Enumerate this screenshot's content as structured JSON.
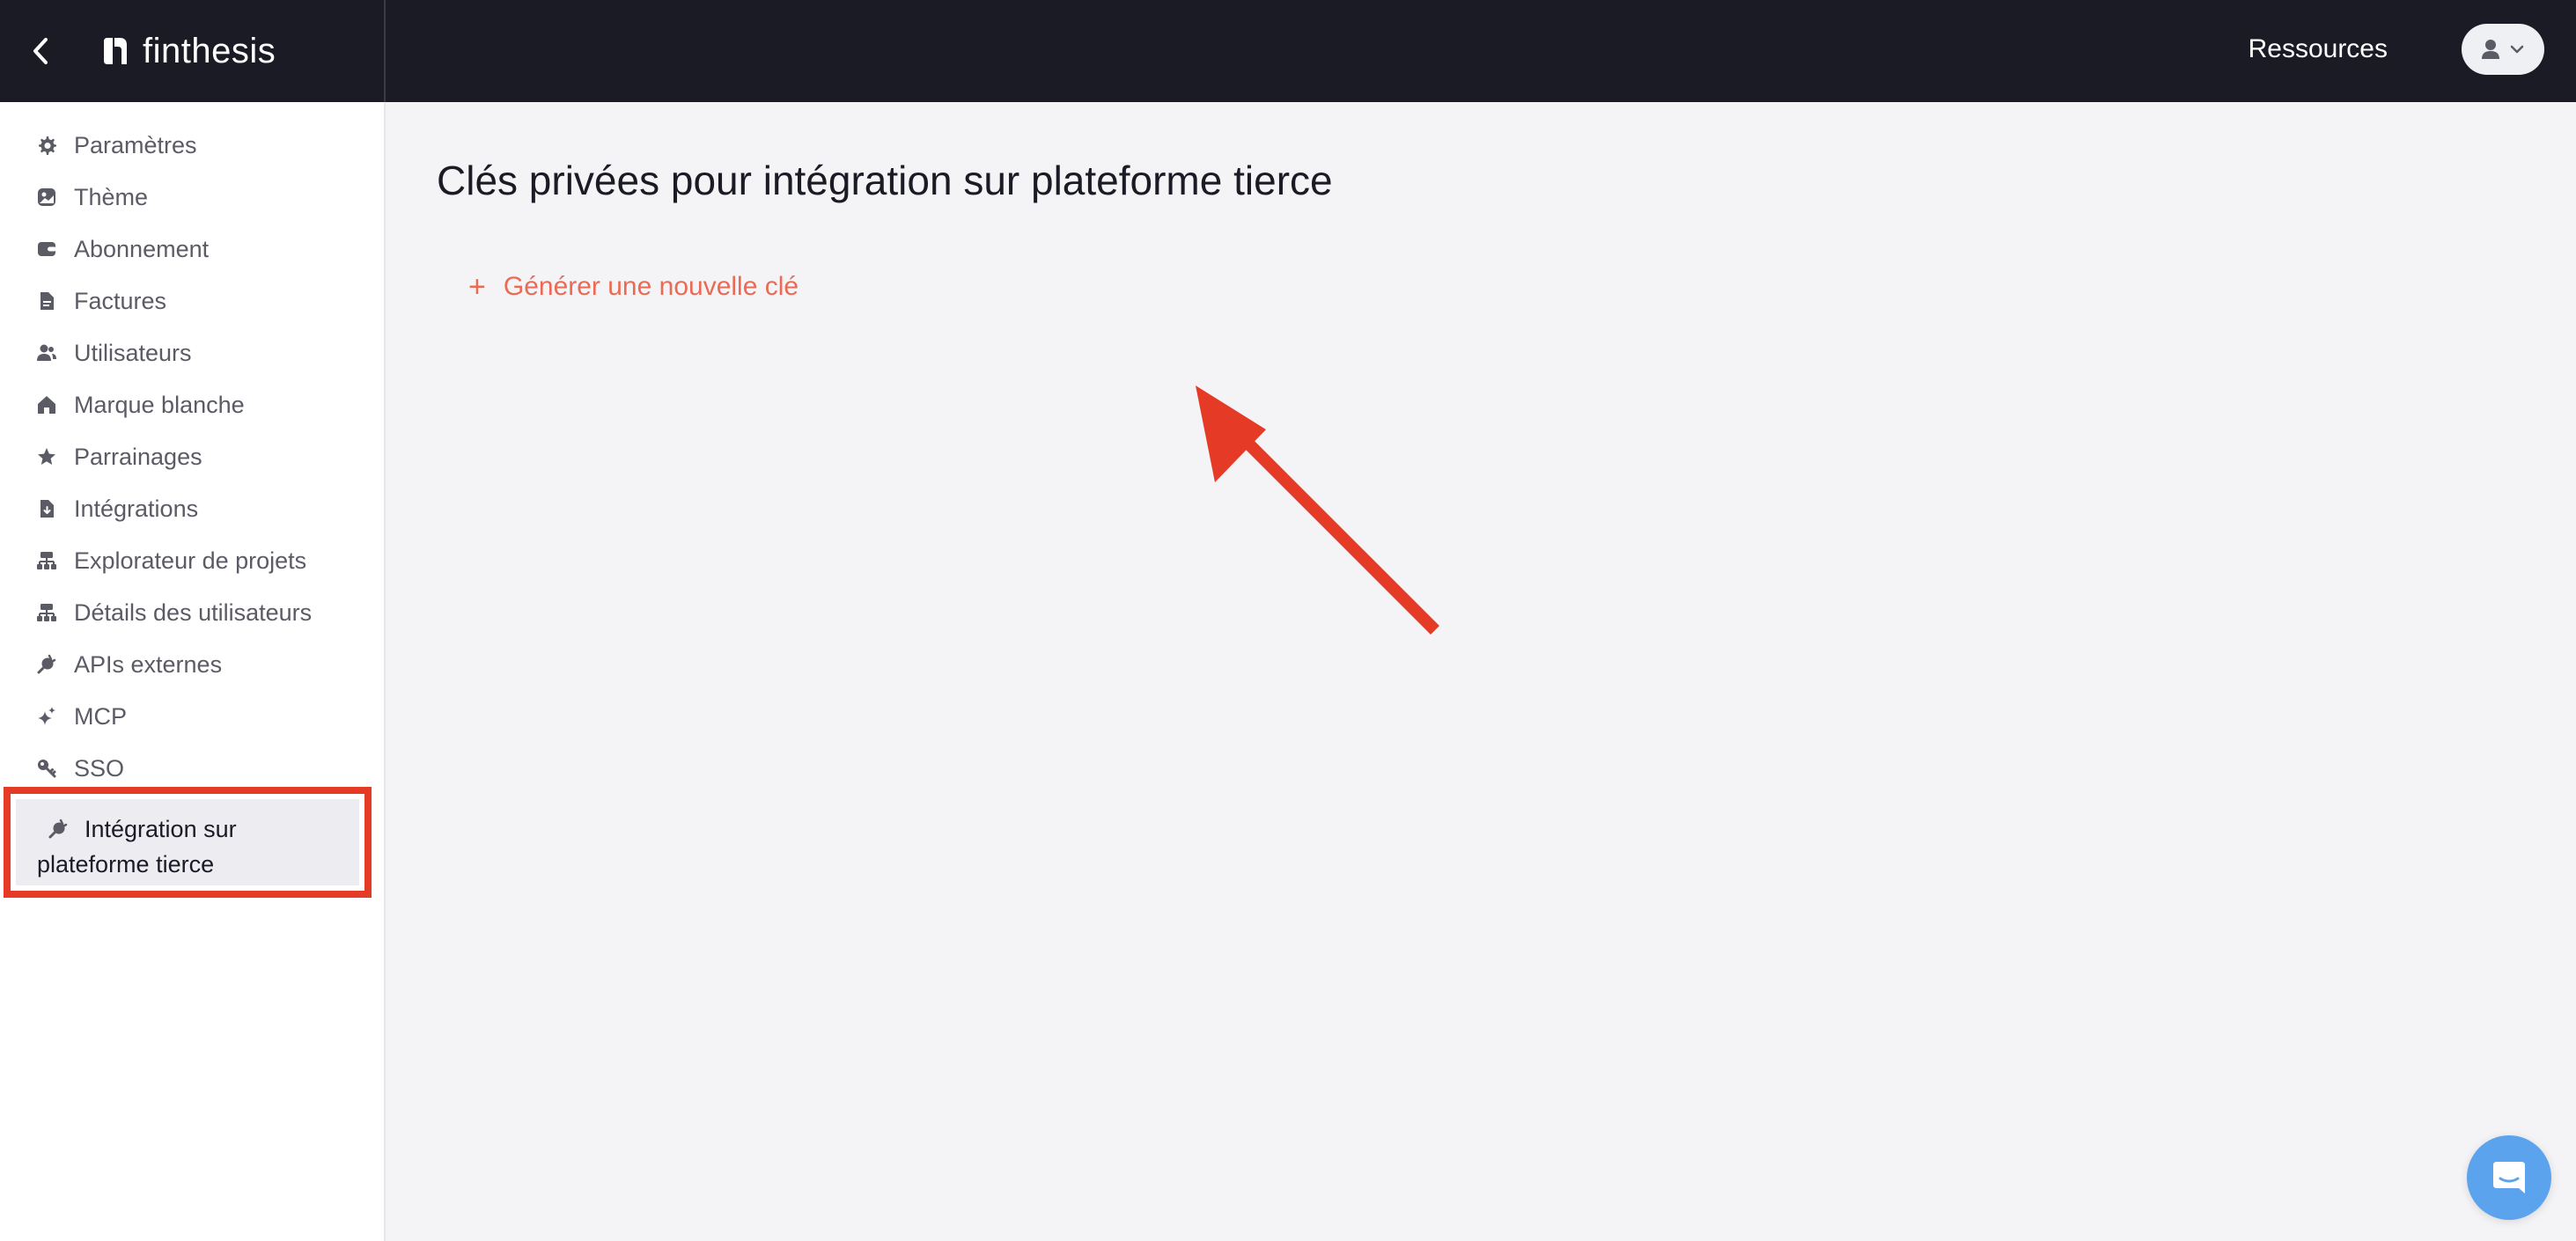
{
  "app": {
    "brand_name": "finthesis",
    "brand_color": "#1b1b26",
    "accent_color": "#ea6b55",
    "highlight_color": "#e53a25"
  },
  "header": {
    "back_icon": "chevron-left-icon",
    "resources_label": "Ressources",
    "user_menu_icons": [
      "user-icon",
      "chevron-down-icon"
    ]
  },
  "sidebar": {
    "items": [
      {
        "label": "Paramètres",
        "icon": "gear-icon"
      },
      {
        "label": "Thème",
        "icon": "image-icon"
      },
      {
        "label": "Abonnement",
        "icon": "wallet-icon"
      },
      {
        "label": "Factures",
        "icon": "document-icon"
      },
      {
        "label": "Utilisateurs",
        "icon": "users-icon"
      },
      {
        "label": "Marque blanche",
        "icon": "home-icon"
      },
      {
        "label": "Parrainages",
        "icon": "star-icon"
      },
      {
        "label": "Intégrations",
        "icon": "document-download-icon"
      },
      {
        "label": "Explorateur de projets",
        "icon": "sitemap-icon"
      },
      {
        "label": "Détails des utilisateurs",
        "icon": "sitemap-icon"
      },
      {
        "label": "APIs externes",
        "icon": "plug-icon"
      },
      {
        "label": "MCP",
        "icon": "sparkles-icon"
      },
      {
        "label": "SSO",
        "icon": "key-icon"
      }
    ],
    "active_item": {
      "label_line1": "Intégration sur",
      "label_line2": "plateforme tierce",
      "icon": "plug-icon"
    }
  },
  "main": {
    "title": "Clés privées pour intégration sur plateforme tierce",
    "generate_button": {
      "icon": "plus-icon",
      "label": "Générer une nouvelle clé"
    }
  },
  "chat": {
    "icon": "chat-bubble-icon",
    "color": "#5ba3ec"
  }
}
